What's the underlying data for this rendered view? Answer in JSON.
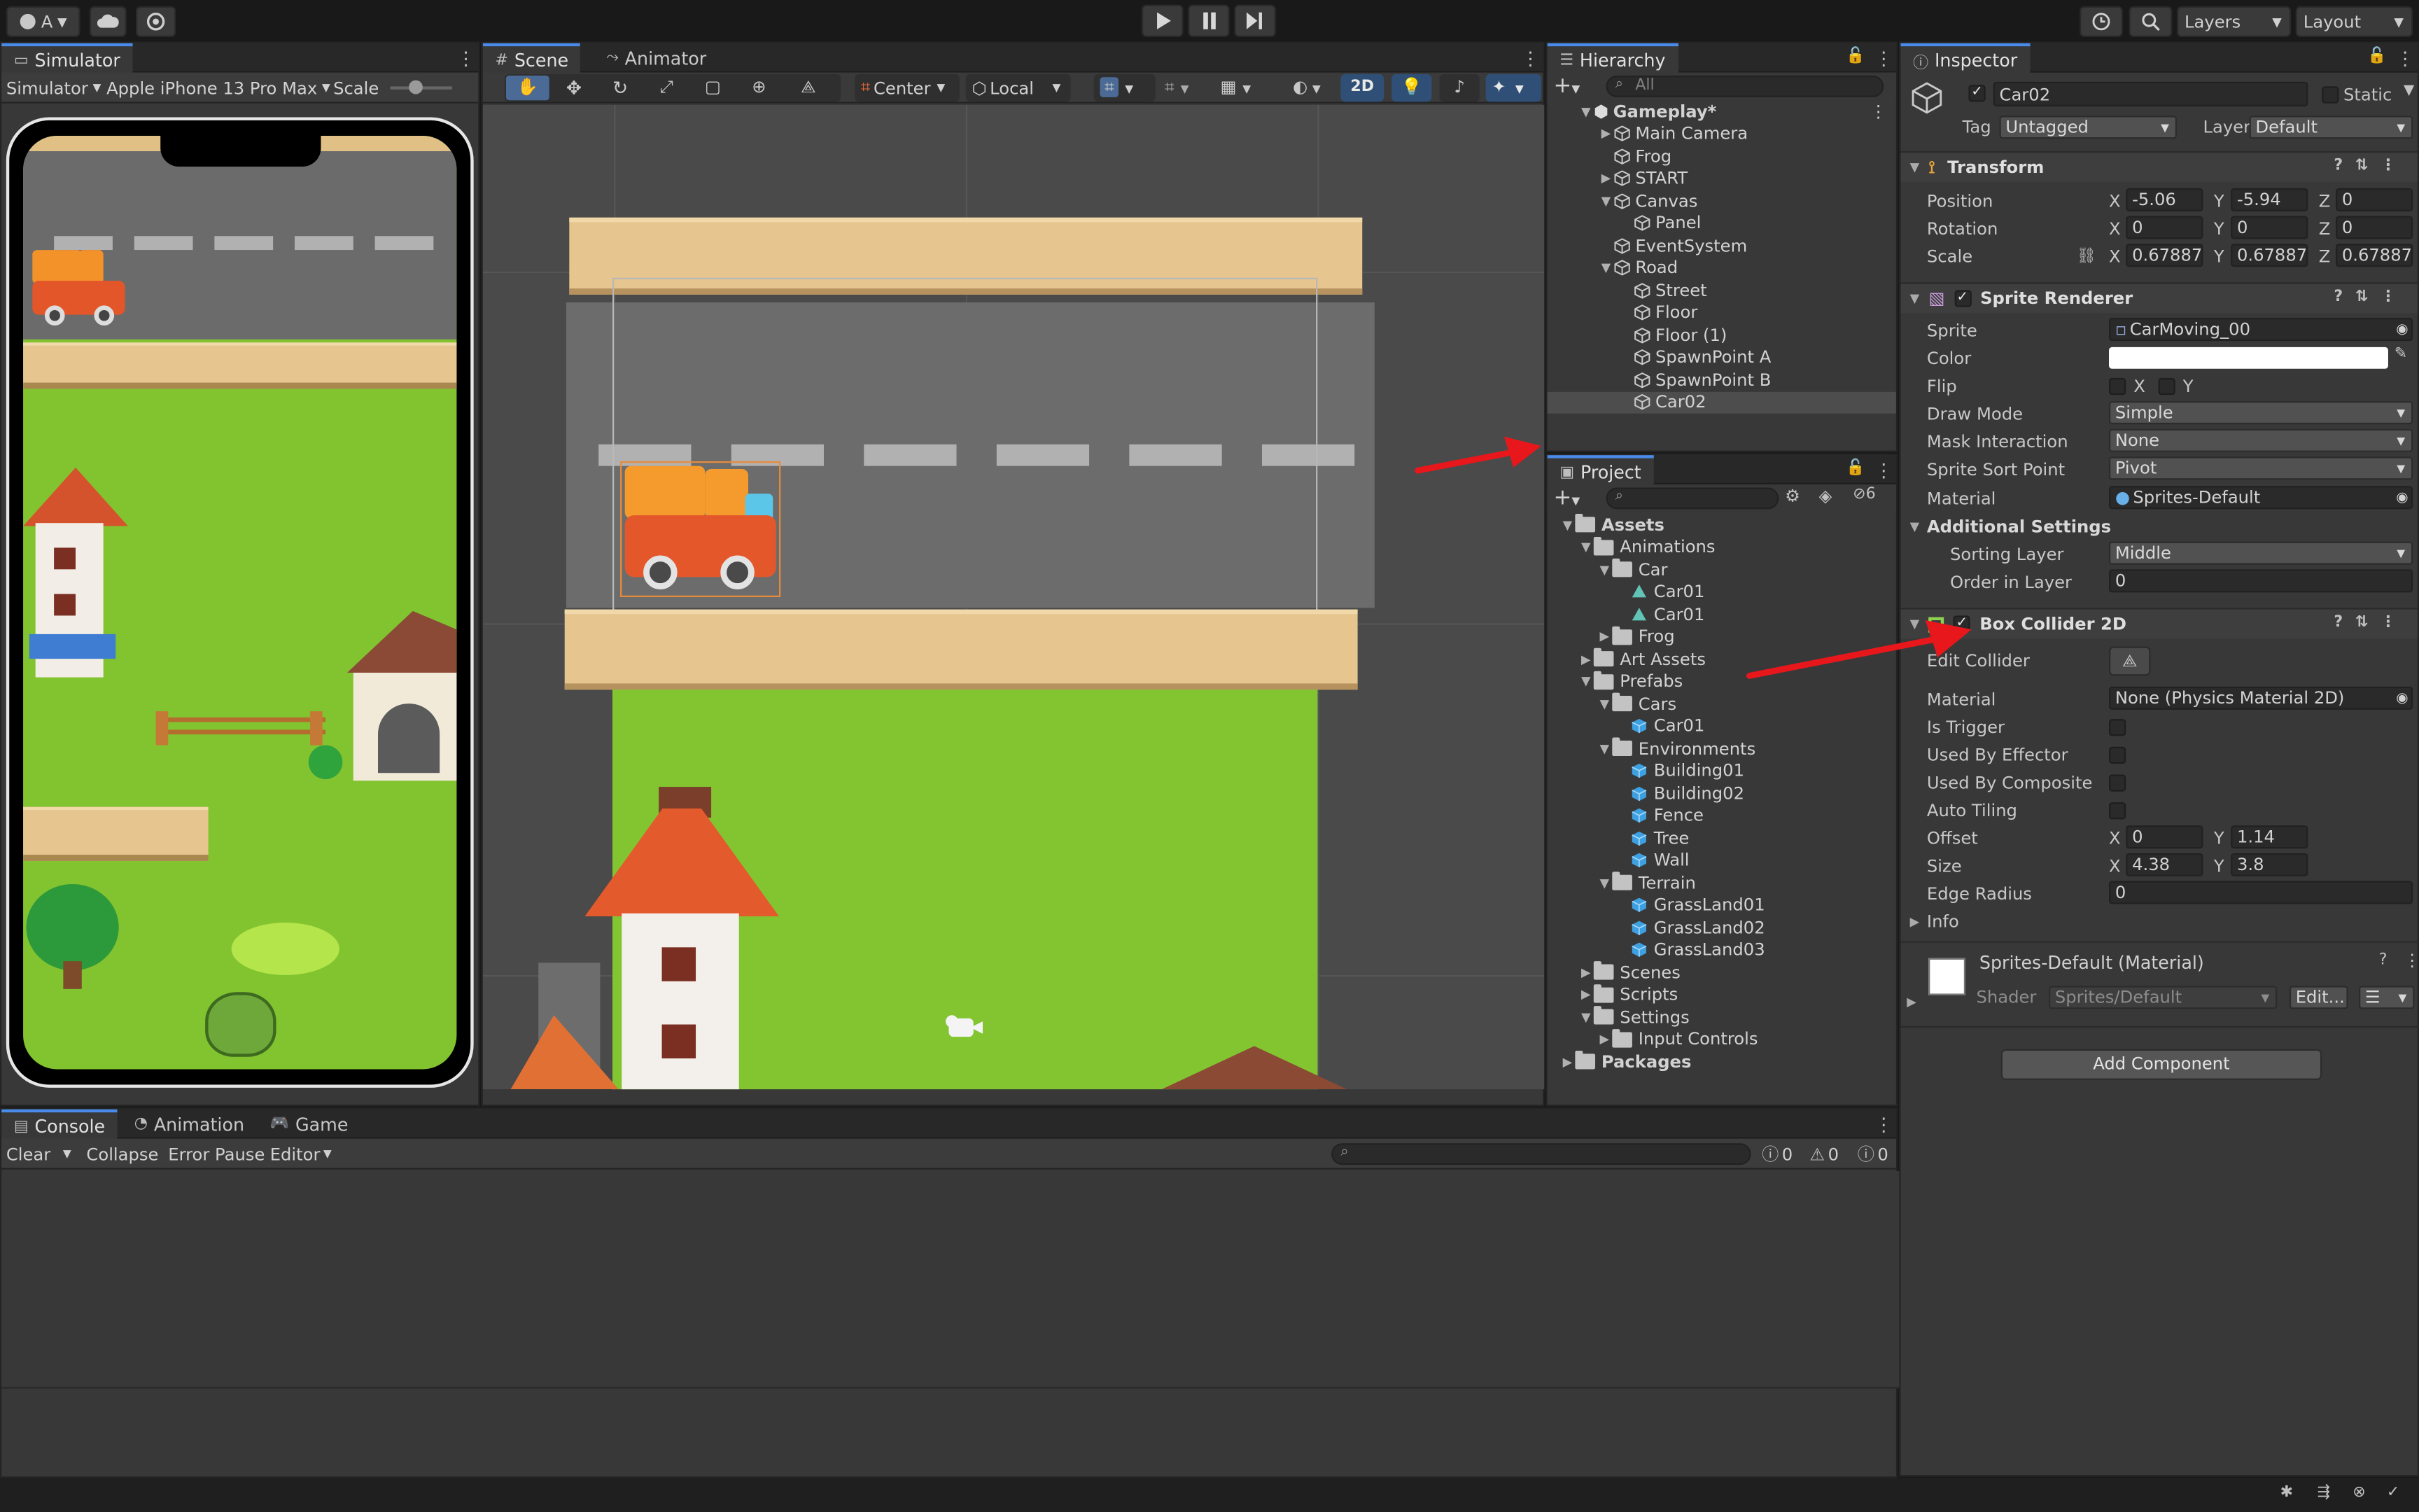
{
  "toolbar": {
    "account_label": "A",
    "layers_label": "Layers",
    "layout_label": "Layout"
  },
  "simulator": {
    "tab_label": "Simulator",
    "mode_label": "Simulator",
    "device_label": "Apple iPhone 13 Pro Max",
    "scale_label": "Scale"
  },
  "scene": {
    "tab_scene": "Scene",
    "tab_animator": "Animator",
    "pivot_label": "Center",
    "space_label": "Local",
    "mode_2d_label": "2D"
  },
  "hierarchy": {
    "tab_label": "Hierarchy",
    "search_placeholder": "All",
    "items": [
      {
        "label": "Gameplay*",
        "depth": 0
      },
      {
        "label": "Main Camera",
        "depth": 1
      },
      {
        "label": "Frog",
        "depth": 1
      },
      {
        "label": "START",
        "depth": 1
      },
      {
        "label": "Canvas",
        "depth": 1
      },
      {
        "label": "Panel",
        "depth": 2
      },
      {
        "label": "EventSystem",
        "depth": 1
      },
      {
        "label": "Road",
        "depth": 1
      },
      {
        "label": "Street",
        "depth": 2
      },
      {
        "label": "Floor",
        "depth": 2
      },
      {
        "label": "Floor (1)",
        "depth": 2
      },
      {
        "label": "SpawnPoint A",
        "depth": 2
      },
      {
        "label": "SpawnPoint B",
        "depth": 2
      },
      {
        "label": "Car02",
        "depth": 2,
        "selected": true
      }
    ]
  },
  "project": {
    "tab_label": "Project",
    "hidden_count": "6",
    "items": [
      {
        "label": "Assets",
        "depth": 0
      },
      {
        "label": "Animations",
        "depth": 1
      },
      {
        "label": "Car",
        "depth": 2
      },
      {
        "label": "Car01",
        "depth": 3
      },
      {
        "label": "Car01",
        "depth": 3
      },
      {
        "label": "Frog",
        "depth": 2
      },
      {
        "label": "Art Assets",
        "depth": 1
      },
      {
        "label": "Prefabs",
        "depth": 1
      },
      {
        "label": "Cars",
        "depth": 2
      },
      {
        "label": "Car01",
        "depth": 3
      },
      {
        "label": "Environments",
        "depth": 2
      },
      {
        "label": "Building01",
        "depth": 3
      },
      {
        "label": "Building02",
        "depth": 3
      },
      {
        "label": "Fence",
        "depth": 3
      },
      {
        "label": "Tree",
        "depth": 3
      },
      {
        "label": "Wall",
        "depth": 3
      },
      {
        "label": "Terrain",
        "depth": 2
      },
      {
        "label": "GrassLand01",
        "depth": 3
      },
      {
        "label": "GrassLand02",
        "depth": 3
      },
      {
        "label": "GrassLand03",
        "depth": 3
      },
      {
        "label": "Scenes",
        "depth": 1
      },
      {
        "label": "Scripts",
        "depth": 1
      },
      {
        "label": "Settings",
        "depth": 1
      },
      {
        "label": "Input Controls",
        "depth": 2
      },
      {
        "label": "Packages",
        "depth": 0
      }
    ]
  },
  "inspector": {
    "tab_label": "Inspector",
    "object_name": "Car02",
    "static_label": "Static",
    "tag_label": "Tag",
    "tag_value": "Untagged",
    "layer_label": "Layer",
    "layer_value": "Default",
    "transform": {
      "title": "Transform",
      "position_label": "Position",
      "position": {
        "x": "-5.06",
        "y": "-5.94",
        "z": "0"
      },
      "rotation_label": "Rotation",
      "rotation": {
        "x": "0",
        "y": "0",
        "z": "0"
      },
      "scale_label": "Scale",
      "scale": {
        "x": "0.678872",
        "y": "0.678872",
        "z": "0.678872"
      }
    },
    "sprite_renderer": {
      "title": "Sprite Renderer",
      "sprite_label": "Sprite",
      "sprite_value": "CarMoving_00",
      "color_label": "Color",
      "flip_label": "Flip",
      "flip_x": "X",
      "flip_y": "Y",
      "draw_mode_label": "Draw Mode",
      "draw_mode_value": "Simple",
      "mask_label": "Mask Interaction",
      "mask_value": "None",
      "sort_point_label": "Sprite Sort Point",
      "sort_point_value": "Pivot",
      "material_label": "Material",
      "material_value": "Sprites-Default",
      "additional_label": "Additional Settings",
      "sorting_layer_label": "Sorting Layer",
      "sorting_layer_value": "Middle",
      "order_label": "Order in Layer",
      "order_value": "0"
    },
    "box_collider": {
      "title": "Box Collider 2D",
      "edit_label": "Edit Collider",
      "material_label": "Material",
      "material_value": "None (Physics Material 2D)",
      "is_trigger_label": "Is Trigger",
      "effector_label": "Used By Effector",
      "composite_label": "Used By Composite",
      "auto_tiling_label": "Auto Tiling",
      "offset_label": "Offset",
      "offset": {
        "x": "0",
        "y": "1.14"
      },
      "size_label": "Size",
      "size": {
        "x": "4.38",
        "y": "3.8"
      },
      "edge_radius_label": "Edge Radius",
      "edge_radius_value": "0",
      "info_label": "Info"
    },
    "material_block": {
      "title": "Sprites-Default (Material)",
      "shader_label": "Shader",
      "shader_value": "Sprites/Default",
      "edit_label": "Edit..."
    },
    "add_component_label": "Add Component"
  },
  "console": {
    "tabs": [
      "Console",
      "Animation",
      "Game"
    ],
    "clear_label": "Clear",
    "collapse_label": "Collapse",
    "error_pause_label": "Error Pause",
    "editor_label": "Editor",
    "info_count": "0",
    "warn_count": "0",
    "error_count": "0"
  },
  "colors": {
    "accent": "#4a8ae8",
    "selection": "#2c5d87",
    "annotation_arrow": "#e8171b"
  }
}
